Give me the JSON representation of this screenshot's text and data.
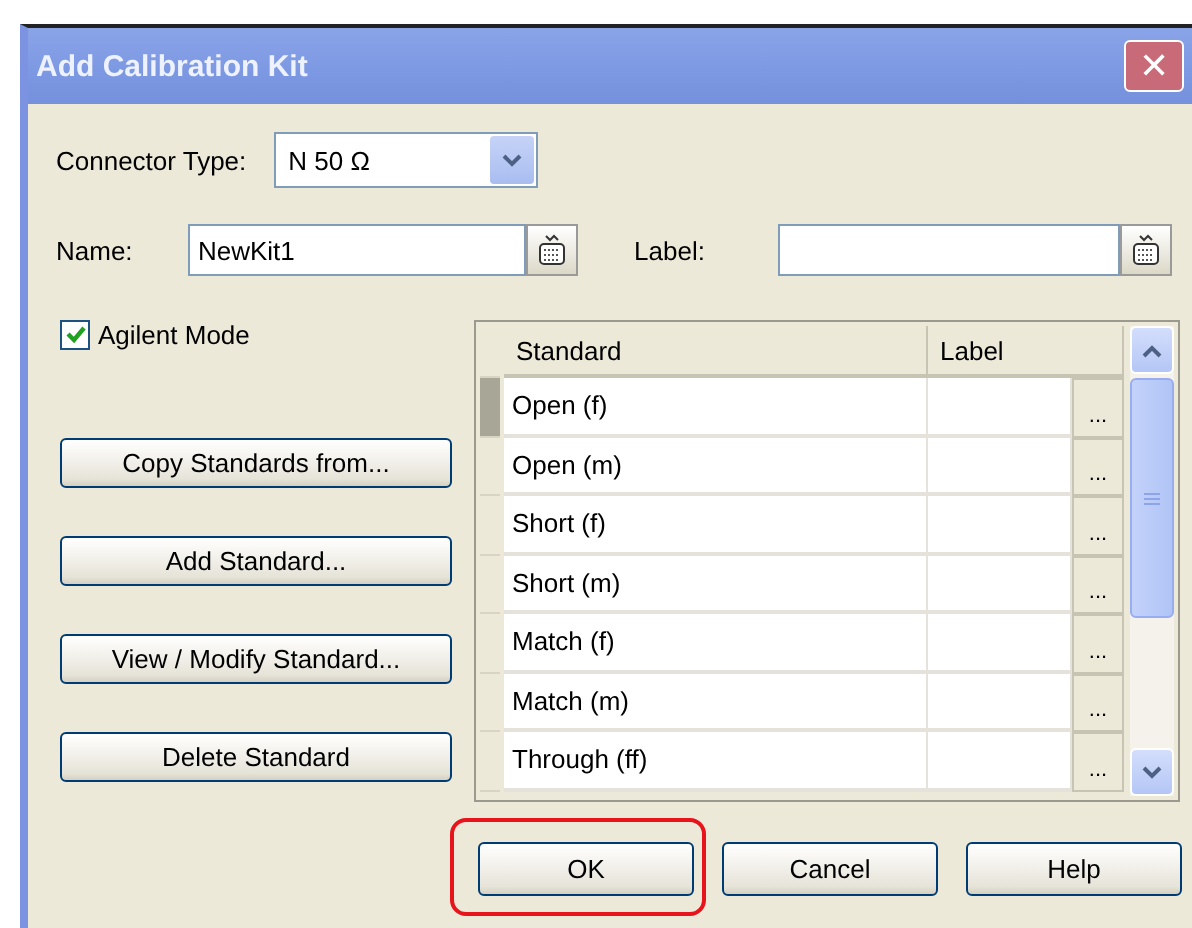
{
  "window": {
    "title": "Add Calibration Kit",
    "close": "✕"
  },
  "connector_type": {
    "label": "Connector Type:",
    "value": "N 50 Ω"
  },
  "name": {
    "label": "Name:",
    "value": "NewKit1"
  },
  "label_field": {
    "label": "Label:"
  },
  "agilent_mode": {
    "label": "Agilent Mode",
    "checked": true
  },
  "side_buttons": [
    "Copy Standards from...",
    "Add Standard...",
    "View / Modify Standard...",
    "Delete Standard"
  ],
  "table": {
    "columns": [
      "Standard",
      "Label"
    ],
    "rows": [
      {
        "standard": "Open (f)",
        "browse": "...",
        "selected": true
      },
      {
        "standard": "Open (m)",
        "browse": "...",
        "selected": false
      },
      {
        "standard": "Short (f)",
        "browse": "...",
        "selected": false
      },
      {
        "standard": "Short (m)",
        "browse": "...",
        "selected": false
      },
      {
        "standard": "Match (f)",
        "browse": "...",
        "selected": false
      },
      {
        "standard": "Match (m)",
        "browse": "...",
        "selected": false
      },
      {
        "standard": "Through (ff)",
        "browse": "...",
        "selected": false
      }
    ]
  },
  "buttons": [
    {
      "label": "OK",
      "highlighted": true
    },
    {
      "label": "Cancel",
      "highlighted": false
    },
    {
      "label": "Help",
      "highlighted": false
    }
  ]
}
